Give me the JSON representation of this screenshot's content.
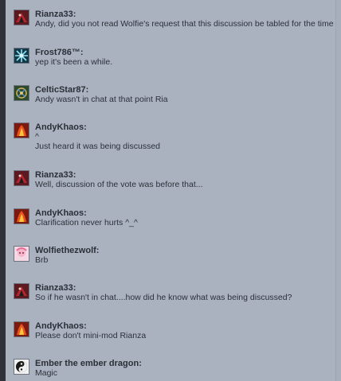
{
  "messages": [
    {
      "user": "Rianza33:",
      "lines": [
        "Andy, did you not read Wolfie's request that this discussion be tabled for the time being?"
      ],
      "avatar": "red-black-dragon-avatar"
    },
    {
      "user": "Frost786™:",
      "lines": [
        "yep it's been a while."
      ],
      "avatar": "ice-crystal-avatar"
    },
    {
      "user": "CelticStar87:",
      "lines": [
        "Andy wasn't in chat at that point Ria"
      ],
      "avatar": "celtic-knot-avatar"
    },
    {
      "user": "AndyKhaos:",
      "lines": [
        "^",
        "Just heard it was being discussed"
      ],
      "avatar": "fire-character-avatar"
    },
    {
      "user": "Rianza33:",
      "lines": [
        "Well, discussion of the vote was before that..."
      ],
      "avatar": "red-black-dragon-avatar"
    },
    {
      "user": "AndyKhaos:",
      "lines": [
        "Clarification never hurts ^_^"
      ],
      "avatar": "fire-character-avatar"
    },
    {
      "user": "Wolfiethezwolf:",
      "lines": [
        "Brb"
      ],
      "avatar": "pink-anime-avatar"
    },
    {
      "user": "Rianza33:",
      "lines": [
        "So if he wasn't in chat....how did he know what was being discussed?"
      ],
      "avatar": "red-black-dragon-avatar"
    },
    {
      "user": "AndyKhaos:",
      "lines": [
        "Please don't mini-mod Rianza"
      ],
      "avatar": "fire-character-avatar"
    },
    {
      "user": "Ember the ember dragon:",
      "lines": [
        "Magic"
      ],
      "avatar": "yin-yang-dragon-avatar"
    }
  ]
}
